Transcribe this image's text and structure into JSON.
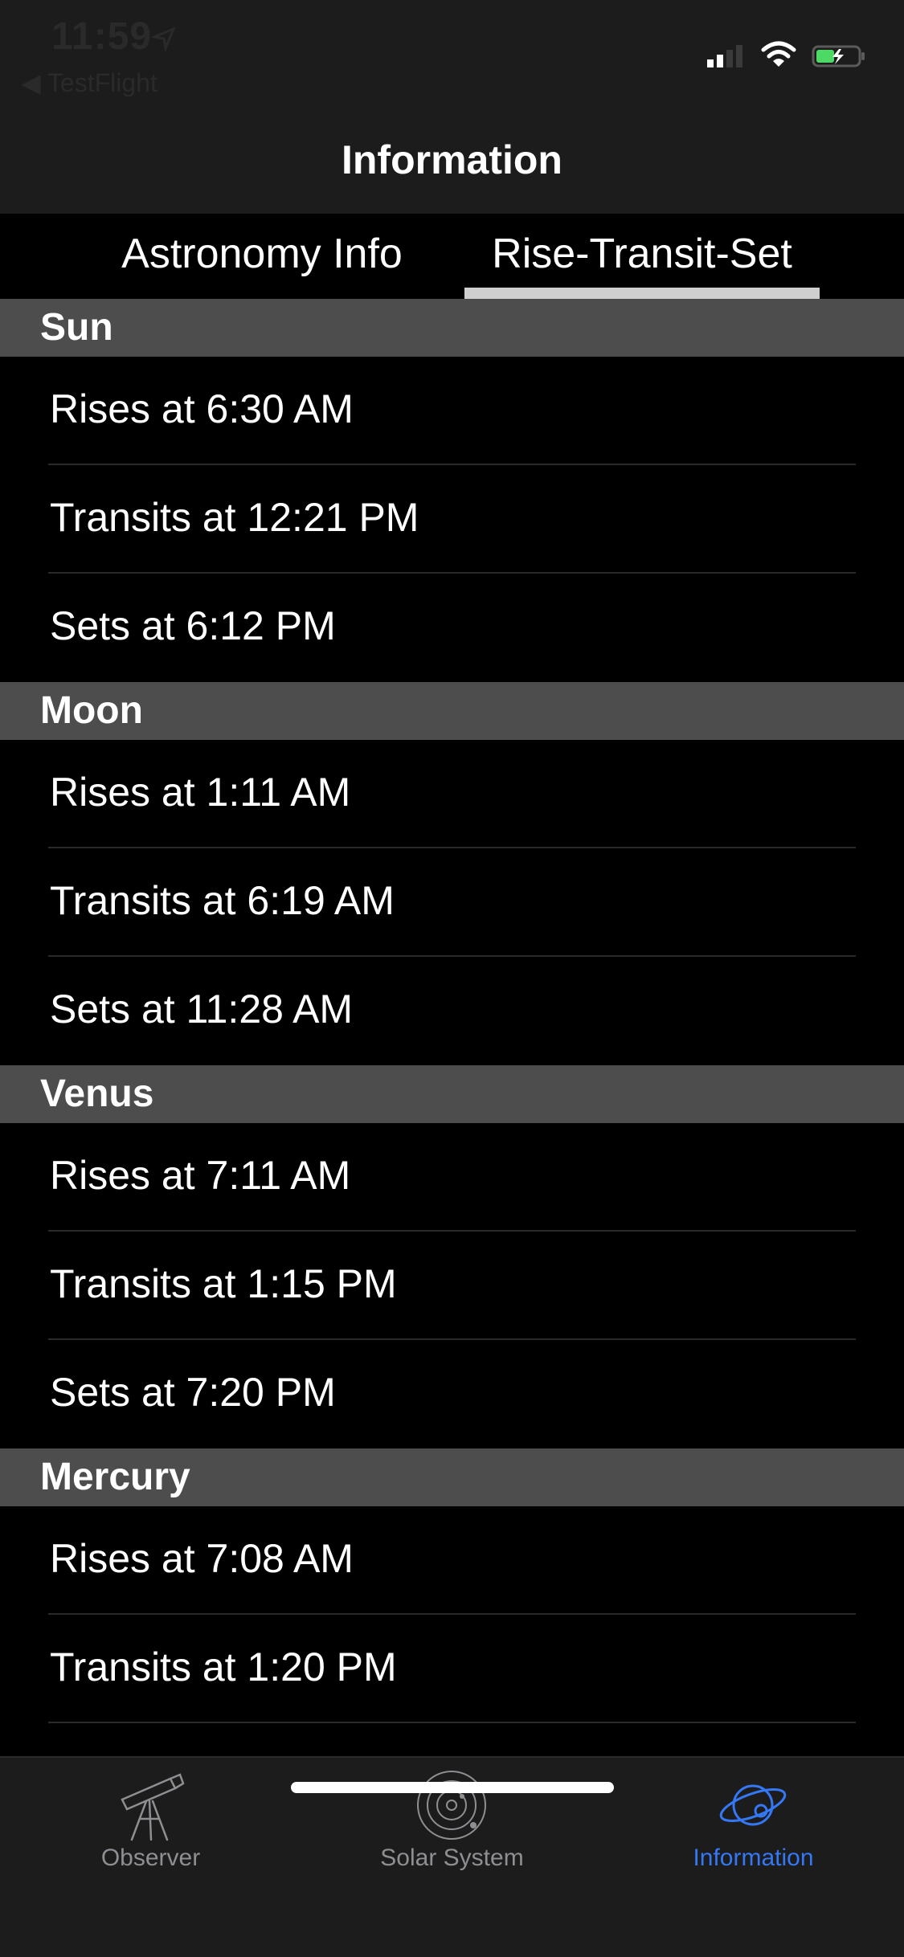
{
  "status_bar": {
    "time": "11:59",
    "back_app": "◀ TestFlight"
  },
  "navbar": {
    "title": "Information"
  },
  "tabs": [
    {
      "label": "Astronomy Info"
    },
    {
      "label": "Rise-Transit-Set"
    }
  ],
  "sections": [
    {
      "title": "Sun",
      "rows": [
        "Rises at 6:30 AM",
        "Transits at 12:21 PM",
        "Sets at 6:12 PM"
      ]
    },
    {
      "title": "Moon",
      "rows": [
        "Rises at 1:11 AM",
        "Transits at 6:19 AM",
        "Sets at 11:28 AM"
      ]
    },
    {
      "title": "Venus",
      "rows": [
        "Rises at 7:11 AM",
        "Transits at 1:15 PM",
        "Sets at 7:20 PM"
      ]
    },
    {
      "title": "Mercury",
      "rows": [
        "Rises at 7:08 AM",
        "Transits at 1:20 PM"
      ]
    }
  ],
  "tabbar": {
    "items": [
      {
        "label": "Observer",
        "icon": "telescope-icon"
      },
      {
        "label": "Solar System",
        "icon": "solar-system-icon"
      },
      {
        "label": "Information",
        "icon": "planet-icon"
      }
    ],
    "active_color": "#3478f6",
    "inactive_color": "#8e8e93"
  }
}
